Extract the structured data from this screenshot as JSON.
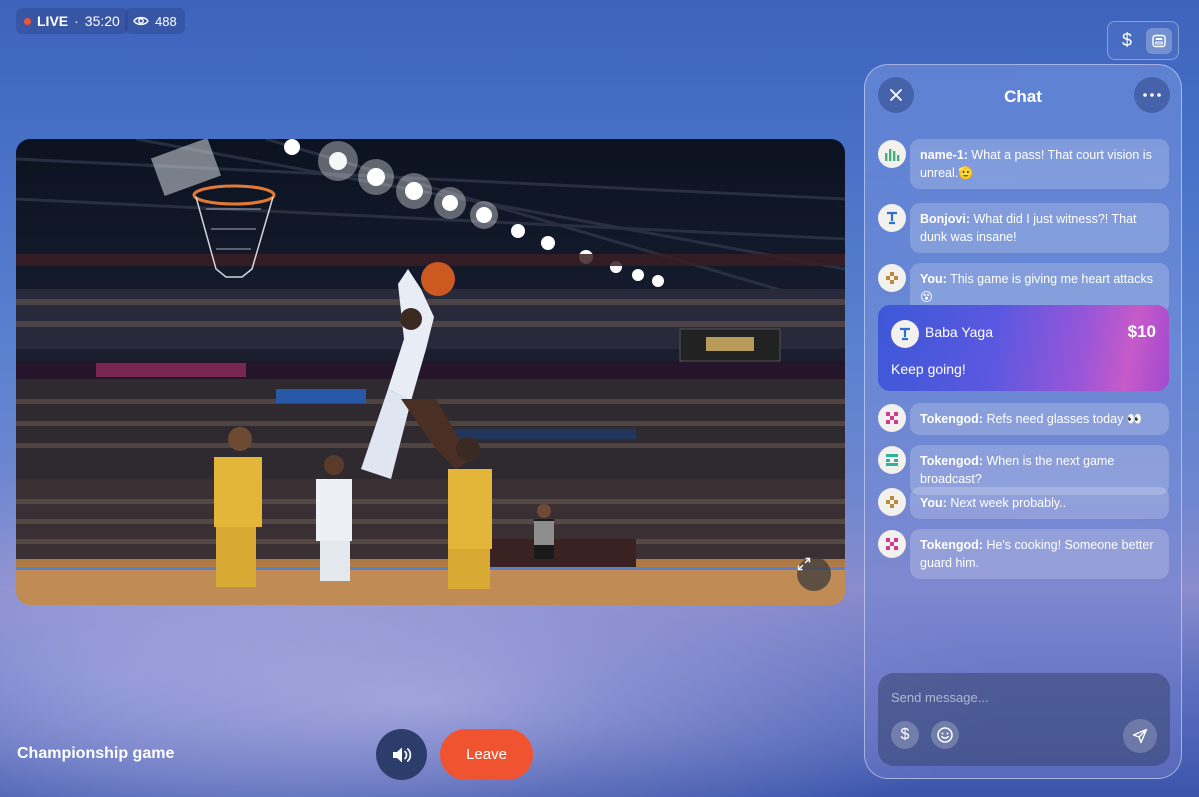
{
  "stream": {
    "live_label": "LIVE",
    "elapsed": "35:20",
    "viewers": "488",
    "game_title": "Championship game"
  },
  "topbar": {
    "dollar_icon": "dollar-icon",
    "panel_icon": "panel-toggle-icon"
  },
  "controls": {
    "volume_icon": "speaker-icon",
    "leave_label": "Leave"
  },
  "chat": {
    "title": "Chat",
    "messages": [
      {
        "user": "name-1:",
        "text": "What a pass! That court vision is unreal.🫡",
        "avatar": "bars-avatar"
      },
      {
        "user": "Bonjovi:",
        "text": "What did I just witness?! That dunk was insane!",
        "avatar": "t-avatar"
      },
      {
        "user": "You:",
        "text": "This game is giving me heart attacks 😵",
        "avatar": "dots-avatar"
      },
      {
        "user": "Tokengod:",
        "text": "Refs need glasses today 👀",
        "avatar": "pink-avatar"
      },
      {
        "user": "Tokengod:",
        "text": "When is the next game broadcast?",
        "avatar": "green-avatar"
      },
      {
        "user": "You:",
        "text": "Next week probably..",
        "avatar": "dots-avatar"
      },
      {
        "user": "Tokengod:",
        "text": "He's cooking! Someone better guard him.",
        "avatar": "pink-avatar"
      }
    ],
    "tip": {
      "name": "Baba Yaga",
      "amount": "$10",
      "message": "Keep going!"
    },
    "composer": {
      "placeholder": "Send message..."
    }
  },
  "colors": {
    "accent": "#f05330",
    "live_dot": "#ef5533",
    "tip_gradient_start": "#3d58d8",
    "tip_gradient_end": "#c65ac8"
  }
}
